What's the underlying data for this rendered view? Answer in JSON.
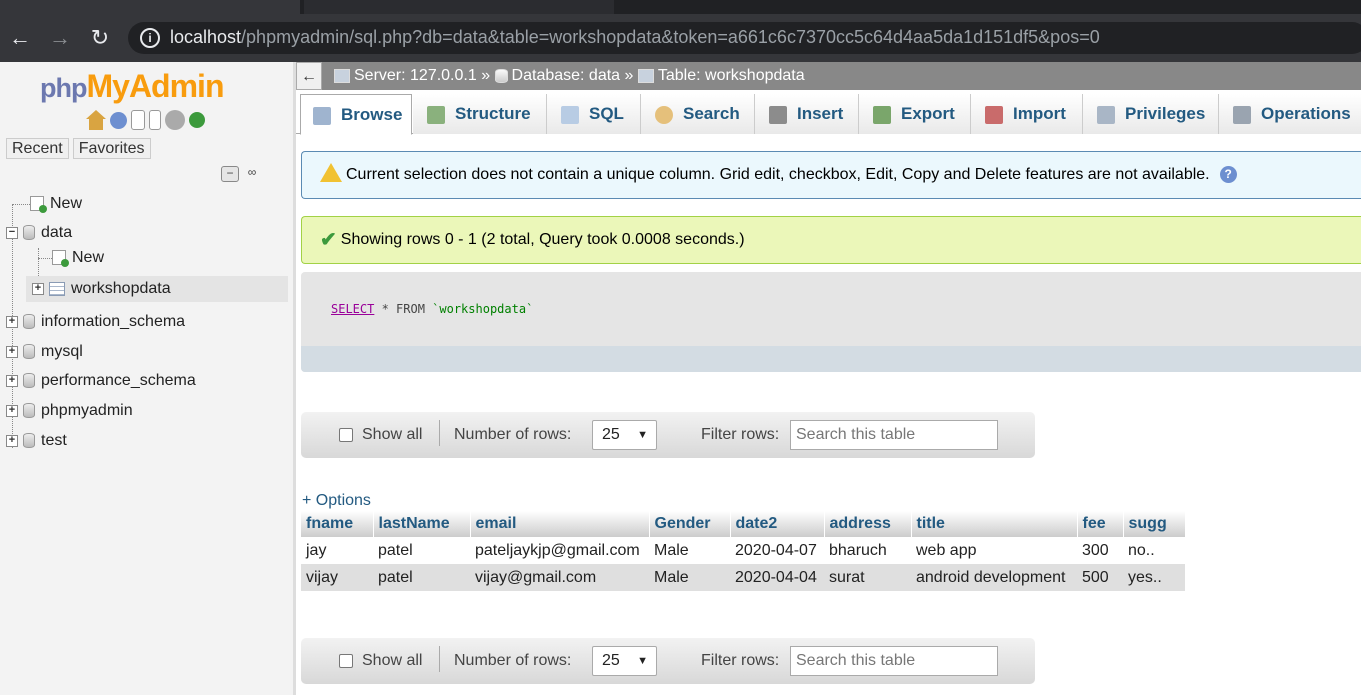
{
  "browser": {
    "url_host": "localhost",
    "url_path": "/phpmyadmin/sql.php?db=data&table=workshopdata&token=a661c6c7370cc5c64d4aa5da1d151df5&pos=0"
  },
  "nav": {
    "logo_php": "php",
    "logo_my": "My",
    "logo_admin": "Admin",
    "recent_label": "Recent",
    "favorites_label": "Favorites",
    "tree": {
      "new_top": "New",
      "data": "data",
      "data_new": "New",
      "workshopdata": "workshopdata",
      "information_schema": "information_schema",
      "mysql": "mysql",
      "performance_schema": "performance_schema",
      "phpmyadmin": "phpmyadmin",
      "test": "test"
    }
  },
  "breadcrumb": {
    "server": "Server: 127.0.0.1 »",
    "database": "Database: data »",
    "table": "Table: workshopdata"
  },
  "tabs": [
    "Browse",
    "Structure",
    "SQL",
    "Search",
    "Insert",
    "Export",
    "Import",
    "Privileges",
    "Operations"
  ],
  "notice": "Current selection does not contain a unique column. Grid edit, checkbox, Edit, Copy and Delete features are not available.",
  "success": "Showing rows 0 - 1 (2 total, Query took 0.0008 seconds.)",
  "sql": {
    "keyword": "SELECT",
    "rest": " * FROM ",
    "table": "`workshopdata`"
  },
  "navigation": {
    "show_all": "Show all",
    "number_of_rows": "Number of rows:",
    "rows_value": "25",
    "filter_rows": "Filter rows:",
    "search_placeholder": "Search this table"
  },
  "options_link": "+ Options",
  "table": {
    "columns": [
      "fname",
      "lastName",
      "email",
      "Gender",
      "date2",
      "address",
      "title",
      "fee",
      "sugg"
    ],
    "rows": [
      [
        "jay",
        "patel",
        "pateljaykjp@gmail.com",
        "Male",
        "2020-04-07",
        "bharuch",
        "web app",
        "300",
        "no.."
      ],
      [
        "vijay",
        "patel",
        "vijay@gmail.com",
        "Male",
        "2020-04-04",
        "surat",
        "android development",
        "500",
        "yes.."
      ]
    ]
  }
}
